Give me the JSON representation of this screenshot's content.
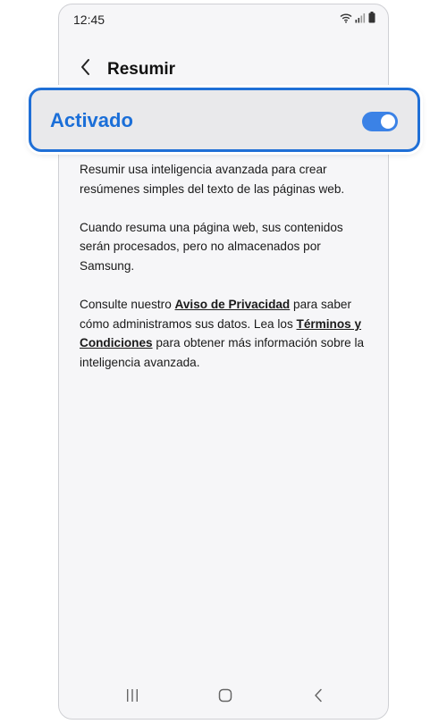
{
  "status_bar": {
    "time": "12:45",
    "icons": [
      "wifi-icon",
      "signal-icon",
      "battery-icon"
    ]
  },
  "header": {
    "back_icon": "chevron-left-icon",
    "title": "Resumir"
  },
  "toggle": {
    "label": "Activado",
    "state": "on",
    "accent_color": "#1f6fd6"
  },
  "description": {
    "paragraph1": "Resumir usa inteligencia avanzada para crear resúmenes simples del texto de las páginas web.",
    "paragraph2": "Cuando resuma una página web, sus contenidos serán procesados, pero no almacenados por Samsung.",
    "paragraph3": {
      "text_before_privacy": "Consulte nuestro ",
      "privacy_link": "Aviso de Privacidad",
      "text_after_privacy": " para saber cómo administramos sus datos. Lea los ",
      "terms_link": "Términos y Condiciones",
      "text_end": " para obtener más información sobre la inteligencia avanzada."
    }
  },
  "nav_bar": {
    "buttons": [
      "recents-icon",
      "home-icon",
      "back-icon"
    ]
  }
}
